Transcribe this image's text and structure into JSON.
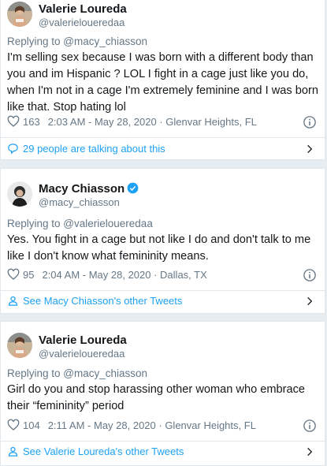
{
  "tweets": [
    {
      "name": "Valerie Loureda",
      "handle": "@valerieloueredaa",
      "replying_prefix": "Replying to ",
      "replying_to": "@macy_chiasson",
      "text": "I'm selling sex because I was born with a different body than you and im Hispanic ? LOL I fight in a cage just like you do, when I'm not in a cage I'm extremely feminine and I was born like that. Stop hating lol",
      "likes": "163",
      "timestamp": "2:03 AM - May 28, 2020 · Glenvar Heights, FL",
      "footer": "29 people are talking about this",
      "footer_icon": "speech-bubble-icon"
    },
    {
      "name": "Macy Chiasson",
      "handle": "@macy_chiasson",
      "verified": true,
      "replying_prefix": "Replying to ",
      "replying_to": "@valerieloueredaa",
      "text": "Yes. You fight in a cage but not like I do and don't talk to me like I don't know what femininity means.",
      "likes": "95",
      "timestamp": "2:04 AM - May 28, 2020 · Dallas, TX",
      "footer": "See Macy Chiasson's other Tweets",
      "footer_icon": "person-icon"
    },
    {
      "name": "Valerie Loureda",
      "handle": "@valerieloueredaa",
      "replying_prefix": "Replying to ",
      "replying_to": "@macy_chiasson",
      "text": "Girl do you and stop harassing other woman who embrace their “femininity” period",
      "likes": "104",
      "timestamp": "2:11 AM - May 28, 2020 · Glenvar Heights, FL",
      "footer": "See Valerie Loureda's other Tweets",
      "footer_icon": "person-icon"
    }
  ],
  "colors": {
    "link": "#1da1f2",
    "secondary_text": "#657786",
    "background": "#e6ecf0"
  }
}
